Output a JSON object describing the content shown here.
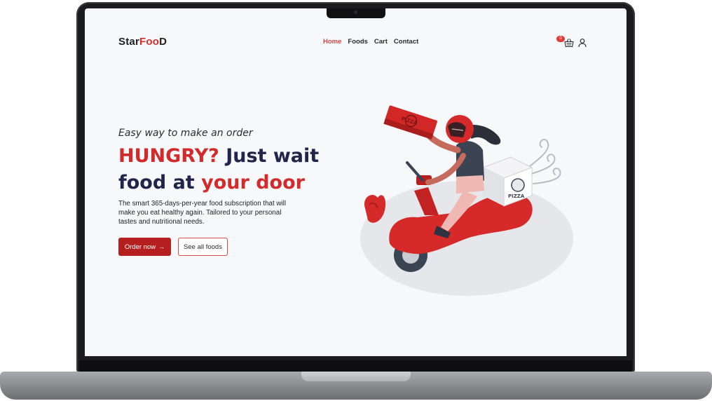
{
  "navbar": {
    "logo_part1": "StarFoo",
    "logo_part2": "D",
    "links": [
      {
        "label": "Home",
        "active": true
      },
      {
        "label": "Foods",
        "active": false
      },
      {
        "label": "Cart",
        "active": false
      },
      {
        "label": "Contact",
        "active": false
      }
    ],
    "cart_count": "0",
    "icons": {
      "cart": "shopping-basket-icon",
      "user": "user-icon"
    }
  },
  "hero": {
    "tagline": "Easy way to make an order",
    "headline": {
      "part1": "HUNGRY?",
      "part2": " Just wait food at ",
      "part3": "your door"
    },
    "description": "The smart 365-days-per-year food subscription that will make you eat healthy again. Tailored to your personal tastes and nutritional needs.",
    "primary_button": "Order now",
    "secondary_button": "See all foods",
    "arrow_icon": "arrow-right-icon"
  },
  "illustration": {
    "pizza_box_text": "PIZZA",
    "delivery_box_text": "PIZZA"
  },
  "colors": {
    "accent_red": "#d32b2b",
    "headline_navy": "#22244a",
    "background": "#f7f8fa"
  }
}
